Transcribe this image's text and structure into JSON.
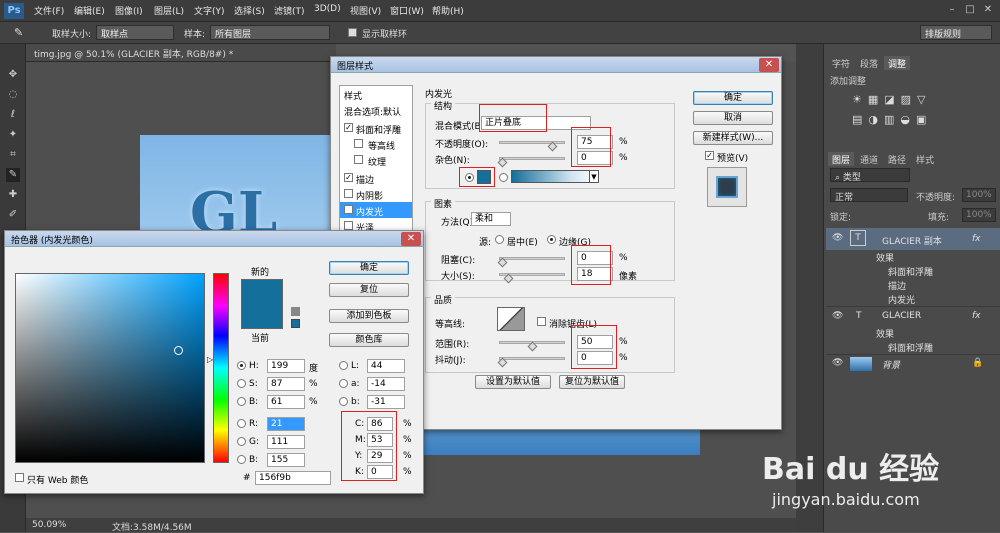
{
  "menubar": {
    "logo": "Ps",
    "items": [
      "文件(F)",
      "编辑(E)",
      "图像(I)",
      "图层(L)",
      "文字(Y)",
      "选择(S)",
      "滤镜(T)",
      "3D(D)",
      "视图(V)",
      "窗口(W)",
      "帮助(H)"
    ]
  },
  "options": {
    "sample_size_label": "取样大小:",
    "sample_size_value": "取样点",
    "sample_label": "样本:",
    "sample_value": "所有图层",
    "show_ring_label": "显示取样环",
    "workspace": "排版规则"
  },
  "document": {
    "tab_title": "timg.jpg @ 50.1% (GLACIER 副本, RGB/8#) *",
    "text": "GL",
    "zoom": "50.09%",
    "doc_info": "文档:3.58M/4.56M"
  },
  "right_panel": {
    "top_tabs": [
      "字符",
      "段落",
      "调整"
    ],
    "add_adjustment": "添加调整",
    "layer_tabs": [
      "图层",
      "通道",
      "路径",
      "样式"
    ],
    "filter_type": "类型",
    "blend_mode": "正常",
    "opacity_label": "不透明度:",
    "opacity_value": "100%",
    "lock_label": "锁定:",
    "fill_label": "填充:",
    "fill_value": "100%",
    "layers": [
      {
        "name": "GLACIER 副本",
        "type": "T",
        "fx": "fx"
      },
      {
        "name": "效果",
        "indent": 1
      },
      {
        "name": "斜面和浮雕",
        "indent": 2
      },
      {
        "name": "描边",
        "indent": 2
      },
      {
        "name": "内发光",
        "indent": 2
      },
      {
        "name": "GLACIER",
        "type": "T",
        "fx": "fx"
      },
      {
        "name": "效果",
        "indent": 1
      },
      {
        "name": "斜面和浮雕",
        "indent": 2
      },
      {
        "name": "背景",
        "type": "bg"
      }
    ]
  },
  "layer_style": {
    "title": "图层样式",
    "styles_header": "样式",
    "blend_options": "混合选项:默认",
    "styles": [
      {
        "label": "斜面和浮雕",
        "checked": true
      },
      {
        "label": "等高线",
        "checked": false,
        "indent": true
      },
      {
        "label": "纹理",
        "checked": false,
        "indent": true
      },
      {
        "label": "描边",
        "checked": true
      },
      {
        "label": "内阴影",
        "checked": false
      },
      {
        "label": "内发光",
        "checked": true,
        "selected": true
      },
      {
        "label": "光泽",
        "checked": false
      }
    ],
    "section_title": "内发光",
    "structure": "结构",
    "blend_mode_label": "混合模式(B):",
    "blend_mode_value": "正片叠底",
    "opacity_label": "不透明度(O):",
    "opacity_value": "75",
    "noise_label": "杂色(N):",
    "noise_value": "0",
    "pct": "%",
    "elements": "图素",
    "method_label": "方法(Q):",
    "method_value": "柔和",
    "source_label": "源:",
    "source_center": "居中(E)",
    "source_edge": "边缘(G)",
    "choke_label": "阻塞(C):",
    "choke_value": "0",
    "size_label": "大小(S):",
    "size_value": "18",
    "px": "像素",
    "quality": "品质",
    "contour_label": "等高线:",
    "antialias_label": "消除锯齿(L)",
    "range_label": "范围(R):",
    "range_value": "50",
    "jitter_label": "抖动(J):",
    "jitter_value": "0",
    "set_default": "设置为默认值",
    "reset_default": "复位为默认值",
    "ok": "确定",
    "cancel": "取消",
    "new_style": "新建样式(W)...",
    "preview": "预览(V)"
  },
  "color_picker": {
    "title": "拾色器 (内发光颜色)",
    "new_label": "新的",
    "current_label": "当前",
    "ok": "确定",
    "reset": "复位",
    "add_swatch": "添加到色板",
    "color_lib": "颜色库",
    "h_label": "H:",
    "h_value": "199",
    "h_unit": "度",
    "s_label": "S:",
    "s_value": "87",
    "s_unit": "%",
    "b_label": "B:",
    "b_value": "61",
    "b_unit": "%",
    "r_label": "R:",
    "r_value": "21",
    "g_label": "G:",
    "g_value": "111",
    "bb_label": "B:",
    "bb_value": "155",
    "l_label": "L:",
    "l_value": "44",
    "a_label": "a:",
    "a_value": "-14",
    "lb_label": "b:",
    "lb_value": "-31",
    "c_label": "C:",
    "c_value": "86",
    "m_label": "M:",
    "m_value": "53",
    "y_label": "Y:",
    "y_value": "29",
    "k_label": "K:",
    "k_value": "0",
    "cmyk_unit": "%",
    "hex_label": "#",
    "hex_value": "156f9b",
    "web_only": "只有 Web 颜色",
    "color": "#156f9b"
  },
  "watermark": {
    "brand": "Bai du 经验",
    "url": "jingyan.baidu.com"
  }
}
